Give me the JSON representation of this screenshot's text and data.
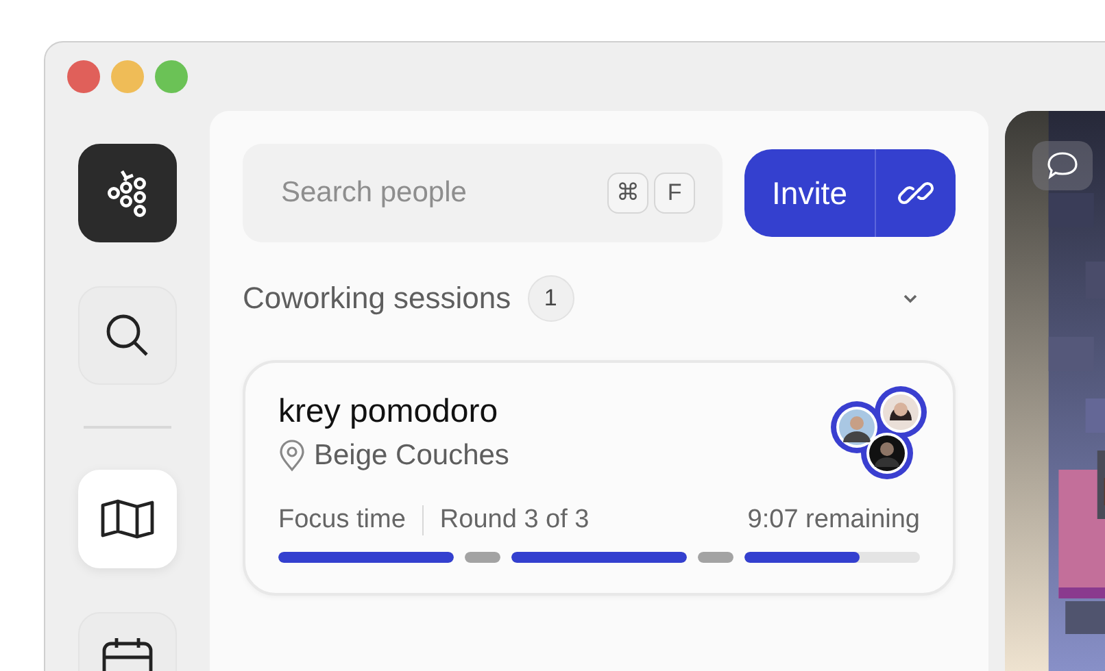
{
  "sidebar": {
    "items": [
      {
        "kind": "logo"
      },
      {
        "kind": "search",
        "selected": false
      },
      {
        "kind": "divider"
      },
      {
        "kind": "map",
        "selected": true
      },
      {
        "kind": "calendar",
        "selected": false
      }
    ]
  },
  "search": {
    "placeholder": "Search people",
    "shortcut": [
      "⌘",
      "F"
    ]
  },
  "invite": {
    "label": "Invite"
  },
  "sessions": {
    "title": "Coworking sessions",
    "count": "1",
    "expanded": true,
    "items": [
      {
        "name": "krey pomodoro",
        "location": "Beige Couches",
        "phase": "Focus time",
        "round": "Round 3 of 3",
        "remaining": "9:07 remaining",
        "segments": [
          {
            "kind": "focus",
            "level": 1
          },
          {
            "kind": "break",
            "level": 1
          },
          {
            "kind": "focus",
            "level": 1
          },
          {
            "kind": "break",
            "level": 1
          },
          {
            "kind": "focus",
            "level": 0.66
          }
        ]
      }
    ]
  }
}
